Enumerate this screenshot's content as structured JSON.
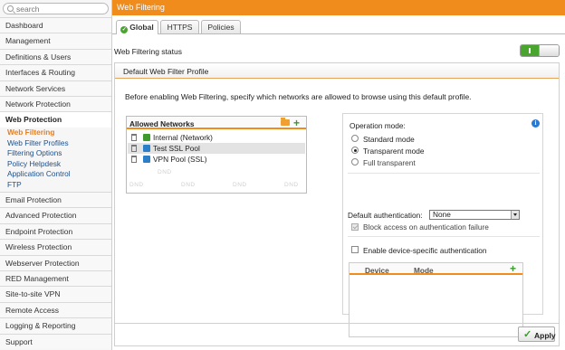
{
  "search": {
    "placeholder": "search"
  },
  "sidebar": {
    "items": [
      {
        "label": "Dashboard"
      },
      {
        "label": "Management"
      },
      {
        "label": "Definitions & Users"
      },
      {
        "label": "Interfaces & Routing"
      },
      {
        "label": "Network Services"
      },
      {
        "label": "Network Protection"
      },
      {
        "label": "Web Protection"
      },
      {
        "label": "Email Protection"
      },
      {
        "label": "Advanced Protection"
      },
      {
        "label": "Endpoint Protection"
      },
      {
        "label": "Wireless Protection"
      },
      {
        "label": "Webserver Protection"
      },
      {
        "label": "RED Management"
      },
      {
        "label": "Site-to-site VPN"
      },
      {
        "label": "Remote Access"
      },
      {
        "label": "Logging & Reporting"
      },
      {
        "label": "Support"
      }
    ],
    "sub_items": [
      {
        "label": "Web Filtering"
      },
      {
        "label": "Web Filter Profiles"
      },
      {
        "label": "Filtering Options"
      },
      {
        "label": "Policy Helpdesk"
      },
      {
        "label": "Application Control"
      },
      {
        "label": "FTP"
      }
    ]
  },
  "header": {
    "title": "Web Filtering",
    "accent_color": "#ef8c1b"
  },
  "tabs": [
    {
      "label": "Global",
      "icon": "check-circle-icon"
    },
    {
      "label": "HTTPS"
    },
    {
      "label": "Policies"
    }
  ],
  "status": {
    "label": "Web Filtering status",
    "enabled": true
  },
  "panel": {
    "title": "Default Web Filter Profile",
    "intro": "Before enabling Web Filtering, specify which networks are allowed to browse using this default profile."
  },
  "networks": {
    "title": "Allowed Networks",
    "rows": [
      {
        "label": "Internal (Network)",
        "icon": "network-icon"
      },
      {
        "label": "Test SSL Pool",
        "icon": "pool-icon"
      },
      {
        "label": "VPN Pool (SSL)",
        "icon": "pool-icon"
      }
    ],
    "dnd": "DND"
  },
  "options": {
    "mode_label": "Operation mode:",
    "modes": [
      "Standard mode",
      "Transparent mode",
      "Full transparent"
    ],
    "selected_mode": "Transparent mode",
    "auth_label": "Default authentication:",
    "auth_value": "None",
    "block_label": "Block access on authentication failure",
    "device_auth_label": "Enable device-specific authentication",
    "device_cols": [
      "Device",
      "Mode"
    ]
  },
  "footer": {
    "apply_label": "Apply"
  }
}
